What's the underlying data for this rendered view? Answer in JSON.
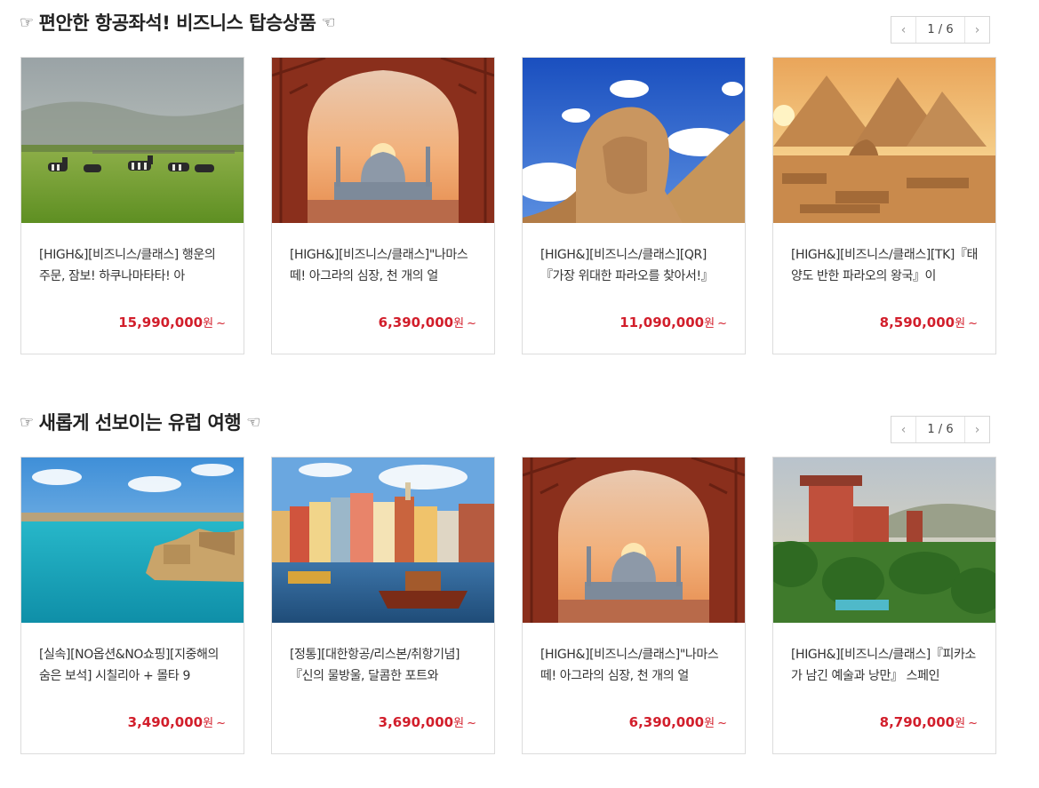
{
  "sections": [
    {
      "title": "편안한 항공좌석! 비즈니스 탑승상품",
      "hand_left": "☞",
      "hand_right": "☜",
      "pager": {
        "prev": "‹",
        "next": "›",
        "counter": "1 / 6"
      },
      "cards": [
        {
          "image": "zebras-savanna",
          "title": "[HIGH&][비즈니스/클래스] 행운의 주문, 잠보! 하쿠나마타타! 아",
          "price": "15,990,000",
          "unit": "원",
          "suffix": "~"
        },
        {
          "image": "taj-mahal-arch",
          "title": "[HIGH&][비즈니스/클래스]\"나마스떼! 아그라의 심장, 천 개의 얼",
          "price": "6,390,000",
          "unit": "원",
          "suffix": "~"
        },
        {
          "image": "sphinx-sky",
          "title": "[HIGH&][비즈니스/클래스][QR]『가장 위대한 파라오를 찾아서!』",
          "price": "11,090,000",
          "unit": "원",
          "suffix": "~"
        },
        {
          "image": "pyramids-sunset",
          "title": "[HIGH&][비즈니스/클래스][TK]『태양도 반한 파라오의 왕국』이",
          "price": "8,590,000",
          "unit": "원",
          "suffix": "~"
        }
      ]
    },
    {
      "title": "새롭게 선보이는 유럽 여행",
      "hand_left": "☞",
      "hand_right": "☜",
      "pager": {
        "prev": "‹",
        "next": "›",
        "counter": "1 / 6"
      },
      "cards": [
        {
          "image": "malta-coast",
          "title": "[실속][NO옵션&NO쇼핑][지중해의 숨은 보석] 시칠리아 + 몰타 9",
          "price": "3,490,000",
          "unit": "원",
          "suffix": "~"
        },
        {
          "image": "porto-riverside",
          "title": "[정통][대한항공/리스본/취항기념]『신의 물방울, 달콤한 포트와",
          "price": "3,690,000",
          "unit": "원",
          "suffix": "~"
        },
        {
          "image": "taj-mahal-arch",
          "title": "[HIGH&][비즈니스/클래스]\"나마스떼! 아그라의 심장, 천 개의 얼",
          "price": "6,390,000",
          "unit": "원",
          "suffix": "~"
        },
        {
          "image": "tenerife-resort",
          "title": "[HIGH&][비즈니스/클래스]『피카소가 남긴 예술과 낭만』 스페인",
          "price": "8,790,000",
          "unit": "원",
          "suffix": "~"
        }
      ]
    }
  ],
  "colors": {
    "price": "#d21e2b",
    "border": "#dcdcdc",
    "text": "#333333"
  }
}
